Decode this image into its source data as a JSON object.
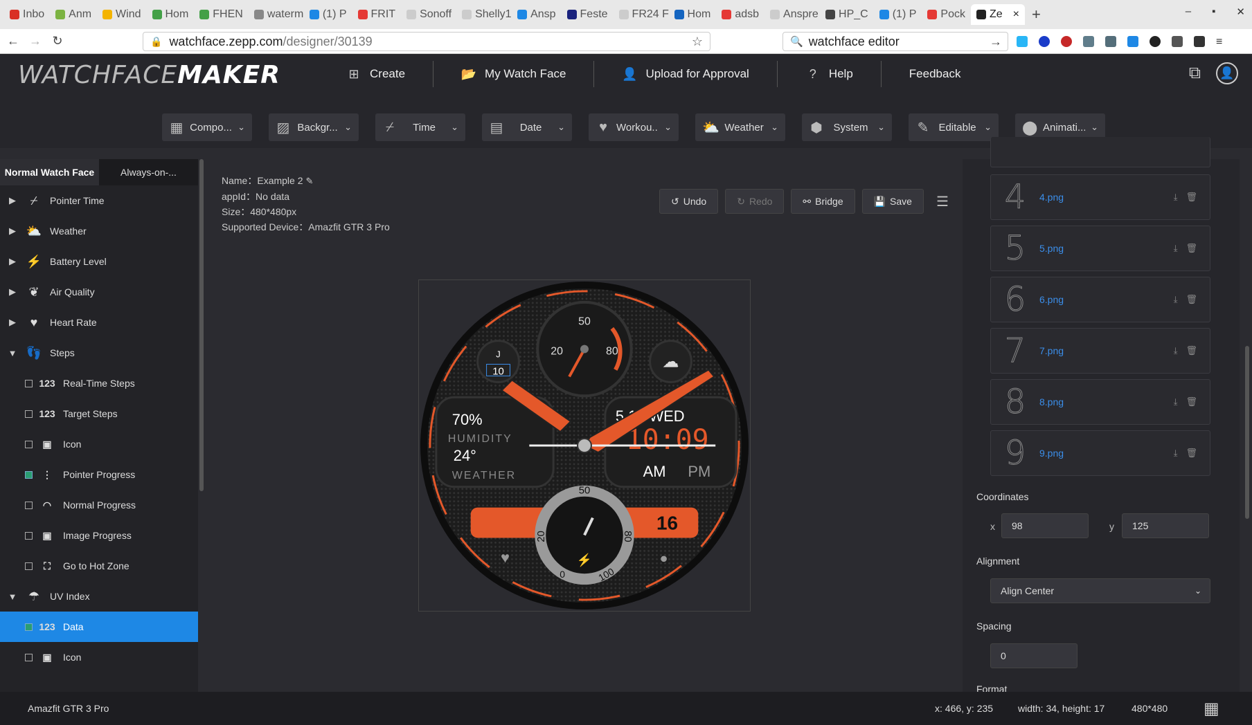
{
  "browser": {
    "tabs": [
      {
        "label": "Inbo",
        "color": "#d93025"
      },
      {
        "label": "Anm",
        "color": "#7cb342"
      },
      {
        "label": "Wind",
        "color": "#f4b400"
      },
      {
        "label": "Hom",
        "color": "#43a047"
      },
      {
        "label": "FHEN",
        "color": "#43a047"
      },
      {
        "label": "waterm",
        "color": "#888888"
      },
      {
        "label": "(1) P",
        "color": "#1e88e5"
      },
      {
        "label": "FRIT",
        "color": "#e53935"
      },
      {
        "label": "Sonoff",
        "color": "#cccccc"
      },
      {
        "label": "Shelly1",
        "color": "#cccccc"
      },
      {
        "label": "Ansp",
        "color": "#1e88e5"
      },
      {
        "label": "Feste",
        "color": "#1a237e"
      },
      {
        "label": "FR24 F",
        "color": "#cccccc"
      },
      {
        "label": "Hom",
        "color": "#1565c0"
      },
      {
        "label": "adsb",
        "color": "#e53935"
      },
      {
        "label": "Anspre",
        "color": "#cccccc"
      },
      {
        "label": "HP_C",
        "color": "#444444"
      },
      {
        "label": "(1) P",
        "color": "#1e88e5"
      },
      {
        "label": "Pock",
        "color": "#e53935"
      }
    ],
    "active_tab": {
      "label": "Ze",
      "close": "×"
    },
    "new_tab": "+",
    "url_host": "watchface.zepp.com",
    "url_path": "/designer/30139",
    "search_text": "watchface editor"
  },
  "app": {
    "logo_light": "WATCHFACE",
    "logo_bold": "MAKER",
    "nav": [
      {
        "label": "Create",
        "icon": "plus-square-icon"
      },
      {
        "label": "My Watch Face",
        "icon": "folder-icon"
      },
      {
        "label": "Upload for Approval",
        "icon": "user-icon"
      },
      {
        "label": "Help",
        "icon": "help-icon"
      },
      {
        "label": "Feedback",
        "icon": ""
      }
    ],
    "components": [
      {
        "label": "Compo...",
        "icon": "grid-icon"
      },
      {
        "label": "Backgr...",
        "icon": "background-icon"
      },
      {
        "label": "Time",
        "icon": "pointer-time-icon"
      },
      {
        "label": "Date",
        "icon": "calendar-icon"
      },
      {
        "label": "Workou...",
        "icon": "heart-icon"
      },
      {
        "label": "Weather",
        "icon": "weather-icon"
      },
      {
        "label": "System",
        "icon": "system-icon"
      },
      {
        "label": "Editable",
        "icon": "editable-icon"
      },
      {
        "label": "Animati...",
        "icon": "animation-icon"
      }
    ]
  },
  "left_panel": {
    "tabs": [
      "Normal Watch Face",
      "Always-on-..."
    ],
    "tree": [
      {
        "label": "Pointer Time",
        "expanded": false,
        "icon": "pointer-icon"
      },
      {
        "label": "Weather",
        "expanded": false,
        "icon": "weather-icon"
      },
      {
        "label": "Battery Level",
        "expanded": false,
        "icon": "bolt-icon"
      },
      {
        "label": "Air Quality",
        "expanded": false,
        "icon": "leaf-icon"
      },
      {
        "label": "Heart Rate",
        "expanded": false,
        "icon": "heart-icon"
      },
      {
        "label": "Steps",
        "expanded": true,
        "icon": "footsteps-icon"
      },
      {
        "label": "Real-Time Steps",
        "child": true,
        "icon": "123"
      },
      {
        "label": "Target Steps",
        "child": true,
        "icon": "123"
      },
      {
        "label": "Icon",
        "child": true,
        "icon": "image-icon"
      },
      {
        "label": "Pointer Progress",
        "child": true,
        "icon": "pointer-progress-icon",
        "checked": true
      },
      {
        "label": "Normal Progress",
        "child": true,
        "icon": "arc-progress-icon"
      },
      {
        "label": "Image Progress",
        "child": true,
        "icon": "image-icon"
      },
      {
        "label": "Go to Hot Zone",
        "child": true,
        "icon": "hotzone-icon"
      },
      {
        "label": "UV Index",
        "expanded": true,
        "icon": "uv-icon"
      },
      {
        "label": "Data",
        "child": true,
        "icon": "123",
        "selected": true,
        "checked": true
      },
      {
        "label": "Icon",
        "child": true,
        "icon": "image-icon"
      }
    ]
  },
  "meta": {
    "name_label": "Name：",
    "name": "Example 2",
    "appid_label": "appId：",
    "appid": "No data",
    "size_label": "Size：",
    "size": "480*480px",
    "device_label": "Supported Device：",
    "device": "Amazfit GTR 3 Pro"
  },
  "toolbar": {
    "undo": "Undo",
    "redo": "Redo",
    "bridge": "Bridge",
    "save": "Save"
  },
  "watch": {
    "humidity": "70%",
    "humidity_label": "HUMIDITY",
    "temp": "24°",
    "weather_label": "WEATHER",
    "date": "5 18 WED",
    "time": "10:09",
    "am": "AM",
    "pm": "PM",
    "uv": "10",
    "uv_letter": "J",
    "steps_value": "16",
    "dial_top": [
      "20",
      "50",
      "80"
    ],
    "dial_bottom": [
      "20",
      "50",
      "80",
      "0",
      "100"
    ]
  },
  "right_panel": {
    "images": [
      {
        "digit": "4",
        "file": "4.png"
      },
      {
        "digit": "5",
        "file": "5.png"
      },
      {
        "digit": "6",
        "file": "6.png"
      },
      {
        "digit": "7",
        "file": "7.png"
      },
      {
        "digit": "8",
        "file": "8.png"
      },
      {
        "digit": "9",
        "file": "9.png"
      }
    ],
    "coordinates_label": "Coordinates",
    "x_label": "x",
    "x_value": "98",
    "y_label": "y",
    "y_value": "125",
    "alignment_label": "Alignment",
    "alignment_value": "Align Center",
    "spacing_label": "Spacing",
    "spacing_value": "0",
    "format_label": "Format"
  },
  "status": {
    "device": "Amazfit GTR 3 Pro",
    "position": "x: 466, y: 235",
    "dims": "width: 34, height: 17",
    "canvas": "480*480"
  }
}
